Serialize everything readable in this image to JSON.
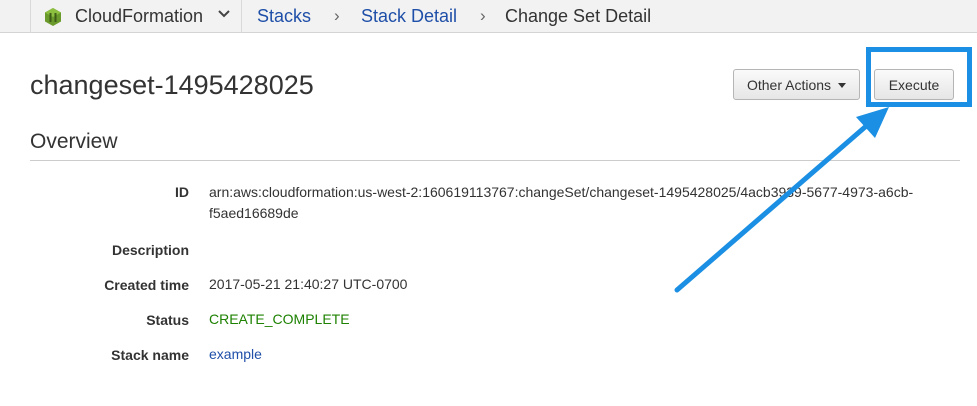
{
  "topbar": {
    "service_name": "CloudFormation",
    "breadcrumbs": [
      {
        "label": "Stacks"
      },
      {
        "label": "Stack Detail"
      },
      {
        "label": "Change Set Detail"
      }
    ]
  },
  "header": {
    "title": "changeset-1495428025",
    "other_actions_label": "Other Actions",
    "execute_label": "Execute"
  },
  "overview": {
    "title": "Overview",
    "fields": [
      {
        "label": "ID",
        "value": "arn:aws:cloudformation:us-west-2:160619113767:changeSet/changeset-1495428025/4acb3939-5677-4973-a6cb-f5aed16689de"
      },
      {
        "label": "Description",
        "value": ""
      },
      {
        "label": "Created time",
        "value": "2017-05-21 21:40:27 UTC-0700"
      },
      {
        "label": "Status",
        "value": "CREATE_COMPLETE"
      },
      {
        "label": "Stack name",
        "value": "example"
      }
    ]
  },
  "colors": {
    "highlight": "#1a8fe3",
    "status_ok": "#1d8102",
    "link": "#1f4fa8"
  }
}
